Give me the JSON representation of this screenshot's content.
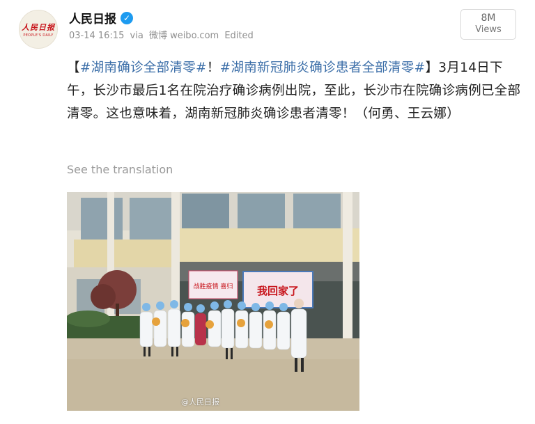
{
  "account": {
    "avatar_logo_cn": "人民日报",
    "avatar_logo_en": "PEOPLE'S DAILY",
    "name": "人民日报",
    "verified_icon": "verified-check-icon",
    "timestamp": "03-14 16:15",
    "via": "via",
    "source": "微博 weibo.com",
    "edited": "Edited"
  },
  "views": {
    "count": "8M",
    "label": "Views"
  },
  "post": {
    "bracket_open": "【",
    "hashtag1": "#湖南确诊全部清零#",
    "sep": "！",
    "hashtag2": "#湖南新冠肺炎确诊患者全部清零#",
    "body": "】3月14日下午，长沙市最后1名在院治疗确诊病例出院，至此，长沙市在院确诊病例已全部清零。这也意味着，湖南新冠肺炎确诊患者清零！（何勇、王云娜）"
  },
  "translate": {
    "label": "See the translation"
  },
  "photo": {
    "banner_left": "战胜疫情 喜归",
    "banner_right": "我回家了",
    "watermark": "@人民日报"
  },
  "colors": {
    "hashtag": "#3b6ea8",
    "brand_red": "#c8161d",
    "verified": "#1d9bf0"
  }
}
